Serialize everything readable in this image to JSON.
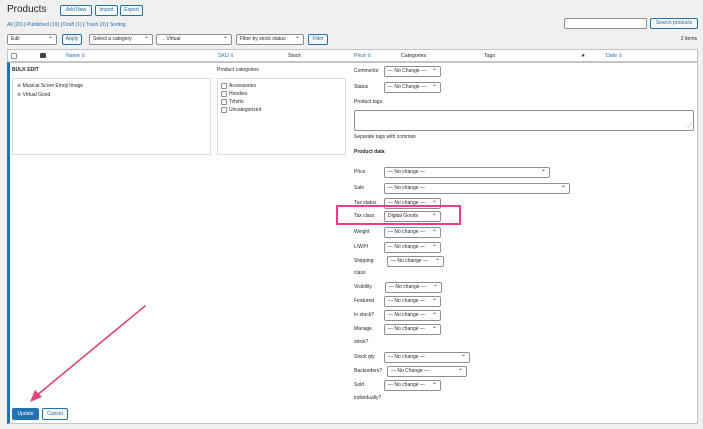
{
  "header": {
    "title": "Products",
    "add_new": "Add New",
    "import": "Import",
    "export": "Export"
  },
  "views": {
    "all": "All (20)",
    "published": "Published (19)",
    "draft": "Draft (1)",
    "trash": "Trash (3)",
    "sorting": "Sorting",
    "sep": "|"
  },
  "search": {
    "value": "",
    "button": "Search products"
  },
  "filters": {
    "bulk_action": "Edit",
    "apply": "Apply",
    "category": "Select a category",
    "product_type": "→ Virtual",
    "stock_status": "Filter by stock status",
    "filter": "Filter",
    "items_count": "2 items"
  },
  "columns": {
    "name": "Name ⇕",
    "sku": "SKU ⇕",
    "stock": "Stock",
    "price": "Price ⇕",
    "categories": "Categories",
    "tags": "Tags",
    "featured": "★",
    "date": "Date ⇕"
  },
  "bulk_edit": {
    "title": "BULK EDIT",
    "items": [
      "Musical Score Emoji Image",
      "Virtual Good"
    ],
    "product_categories_title": "Product categories",
    "categories": [
      "Accessories",
      "Hoodies",
      "Tshirts",
      "Uncategorized"
    ]
  },
  "fields": {
    "comments_label": "Comments",
    "comments_value": "— No Change —",
    "status_label": "Status",
    "status_value": "— No Change —",
    "product_tags_label": "Product tags",
    "tags_hint": "Separate tags with commas",
    "product_data_label": "Product data",
    "price_label": "Price",
    "price_value": "— No change —",
    "sale_label": "Sale",
    "sale_value": "— No change —",
    "tax_status_label": "Tax status",
    "tax_status_value": "— No change —",
    "tax_class_label": "Tax class",
    "tax_class_value": "Digital Goods",
    "weight_label": "Weight",
    "weight_value": "— No change —",
    "lwh_label": "L/W/H",
    "lwh_value": "— No change —",
    "shipping_label_1": "Shipping",
    "shipping_label_2": "class",
    "shipping_value": "— No change —",
    "visibility_label": "Visibility",
    "visibility_value": "— No change —",
    "featured_label": "Featured",
    "featured_value": "— No change —",
    "instock_label": "In stock?",
    "instock_value": "— No change —",
    "manage_label_1": "Manage",
    "manage_label_2": "stock?",
    "manage_value": "— No change —",
    "stockqty_label": "Stock qty",
    "stockqty_value": "— No change —",
    "backorders_label": "Backorders?",
    "backorders_value": "— No Change —",
    "sold_label_1": "Sold",
    "sold_label_2": "individually?",
    "sold_value": "— No change —"
  },
  "actions": {
    "update": "Update",
    "cancel": "Cancel"
  },
  "colors": {
    "accent": "#2271b1",
    "highlight": "#e83e8c",
    "arrow": "#e0457b"
  }
}
